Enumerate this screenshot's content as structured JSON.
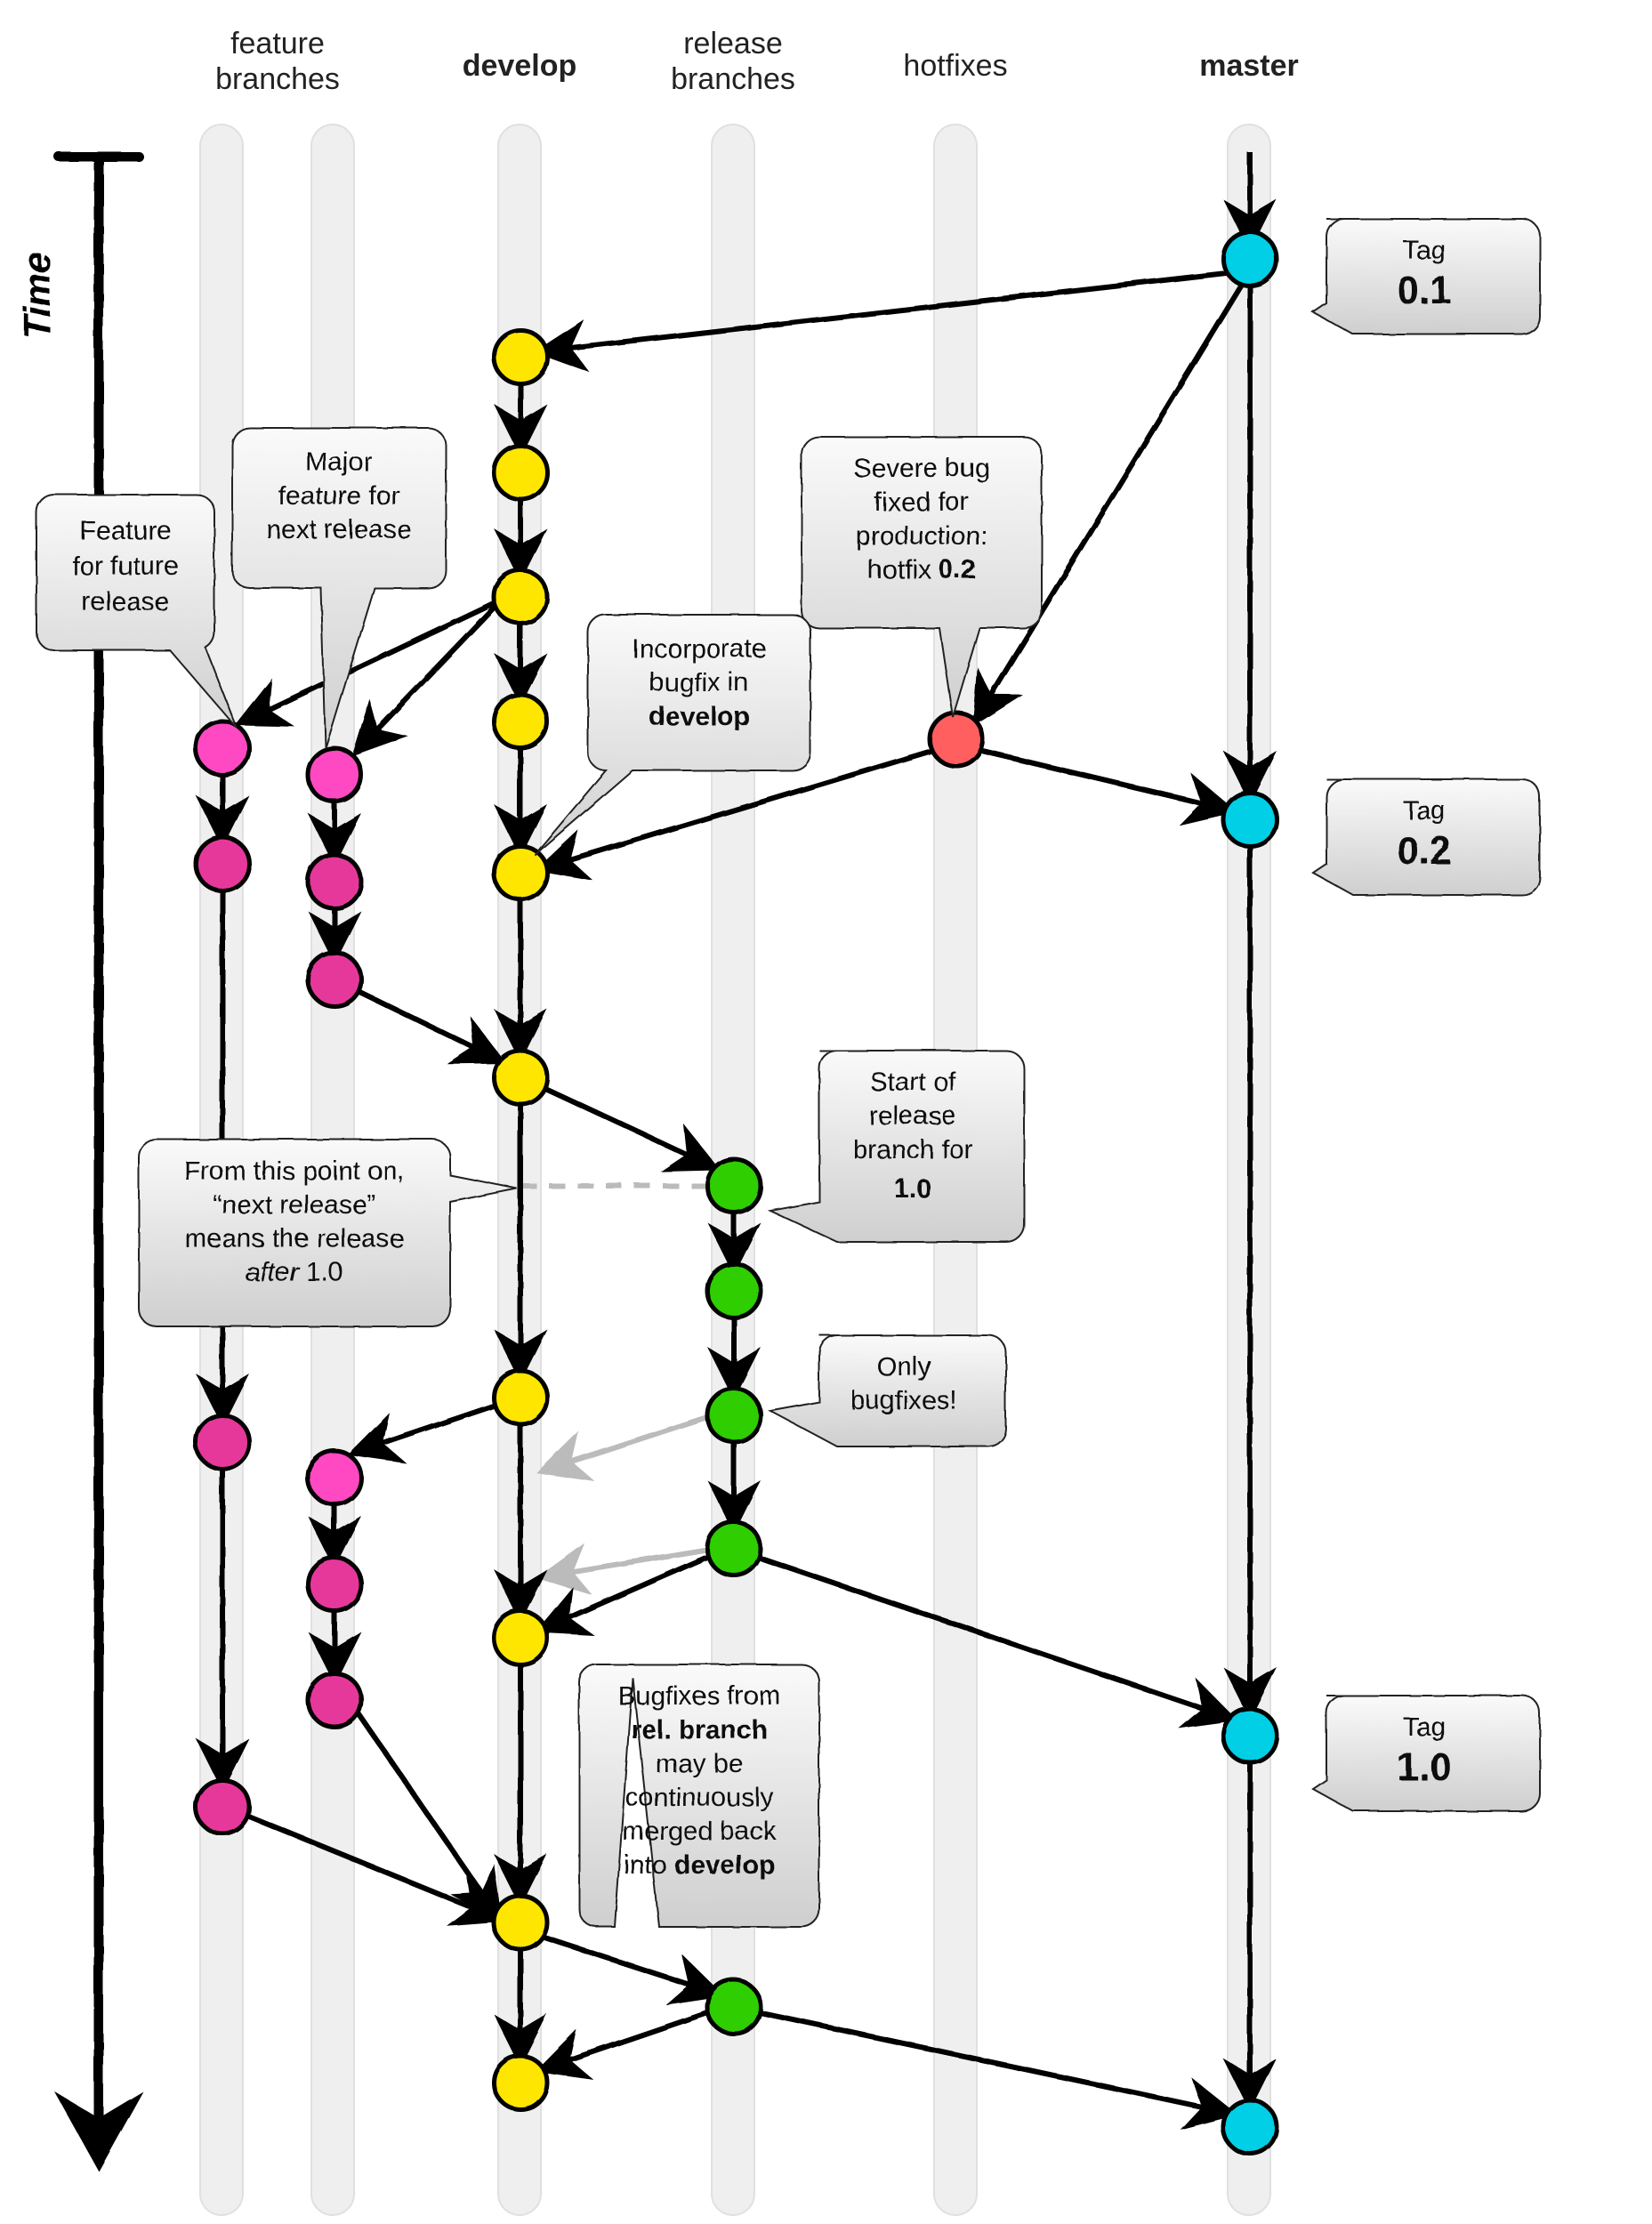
{
  "labels": {
    "time": "Time",
    "feature": "feature branches",
    "develop": "develop",
    "release": "release branches",
    "hotfixes": "hotfixes",
    "master": "master"
  },
  "tags": {
    "t1": {
      "title": "Tag",
      "value": "0.1"
    },
    "t2": {
      "title": "Tag",
      "value": "0.2"
    },
    "t3": {
      "title": "Tag",
      "value": "1.0"
    }
  },
  "callouts": {
    "featureFuture": "Feature for future release",
    "majorFeature": "Major feature for next release",
    "severeBug": "Severe bug fixed for production: hotfix 0.2",
    "incorporate": "Incorporate bugfix in develop",
    "startRelease": "Start of release branch for 1.0",
    "nextRelease": "From this point on, \"next release\" means the release after 1.0",
    "onlyBugfixes": "Only bugfixes!",
    "continuousMerge": "Bugfixes from rel. branch may be continuously merged back into develop"
  },
  "colors": {
    "feature1": "#ff49c3",
    "feature2": "#e6399b",
    "develop": "#ffe600",
    "release": "#2fce00",
    "hotfix": "#ff5e5e",
    "master": "#00cfe6"
  }
}
